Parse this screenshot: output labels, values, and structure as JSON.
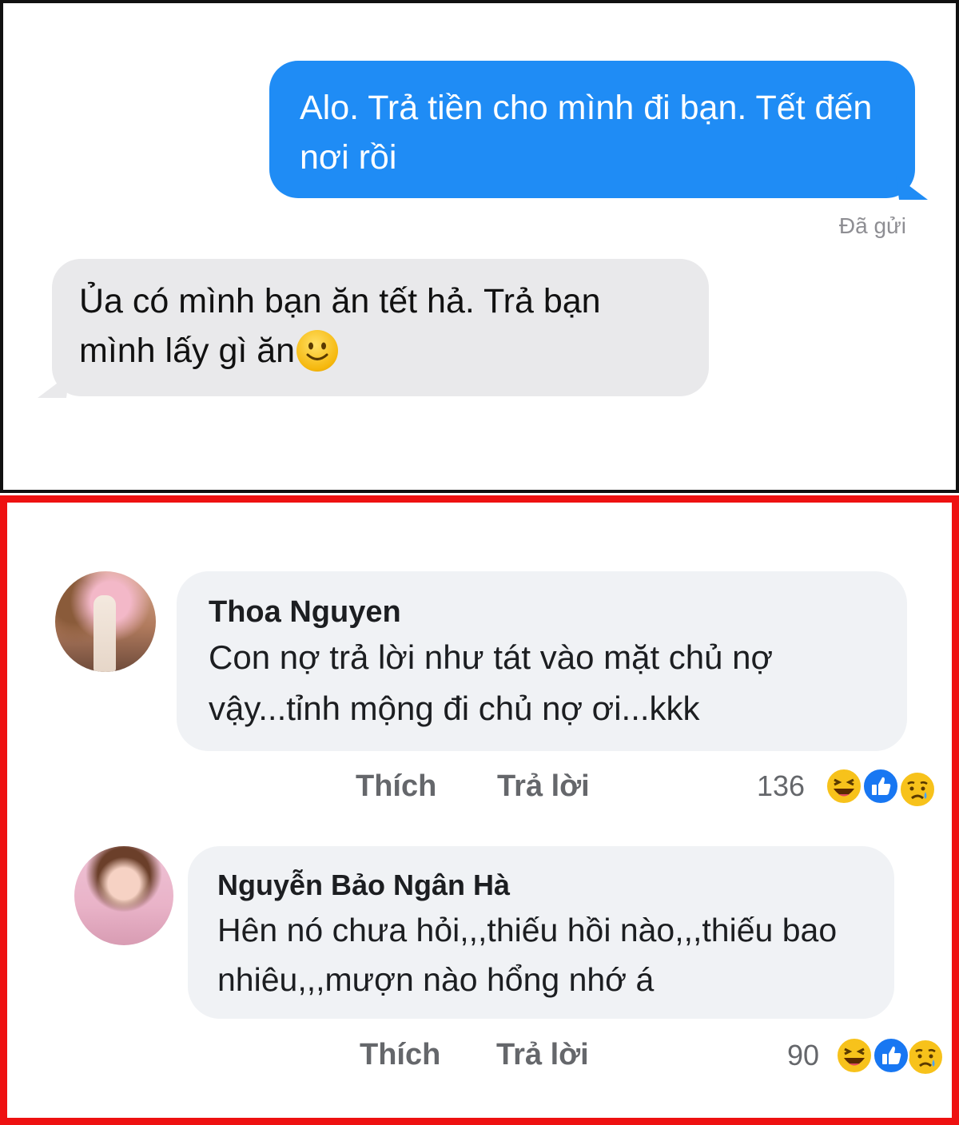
{
  "chat": {
    "sent_message": "Alo. Trả tiền cho mình đi bạn. Tết đến nơi rồi",
    "status": "Đã gửi",
    "received_message": "Ủa có mình bạn ăn tết hả. Trả bạn mình lấy gì ăn",
    "received_emoji": "slightly-smiling-face-icon"
  },
  "comments": [
    {
      "author": "Thoa Nguyen",
      "text": "Con nợ trả lời như tát vào mặt chủ nợ vậy...tỉnh mộng đi chủ nợ ơi...kkk",
      "like_label": "Thích",
      "reply_label": "Trả lời",
      "reaction_count": "136",
      "reactions": [
        "haha-icon",
        "like-icon",
        "sad-icon"
      ]
    },
    {
      "author": "Nguyễn Bảo Ngân Hà",
      "text": "Hên nó chưa hỏi,,,thiếu hồi nào,,,thiếu bao nhiêu,,,mượn nào hổng nhớ á",
      "like_label": "Thích",
      "reply_label": "Trả lời",
      "reaction_count": "90",
      "reactions": [
        "haha-icon",
        "like-icon",
        "sad-icon"
      ]
    }
  ],
  "colors": {
    "sent_bubble": "#1f8cf5",
    "received_bubble": "#e9e9eb",
    "comment_bubble": "#f0f2f5",
    "highlight_border": "#ee1111"
  }
}
